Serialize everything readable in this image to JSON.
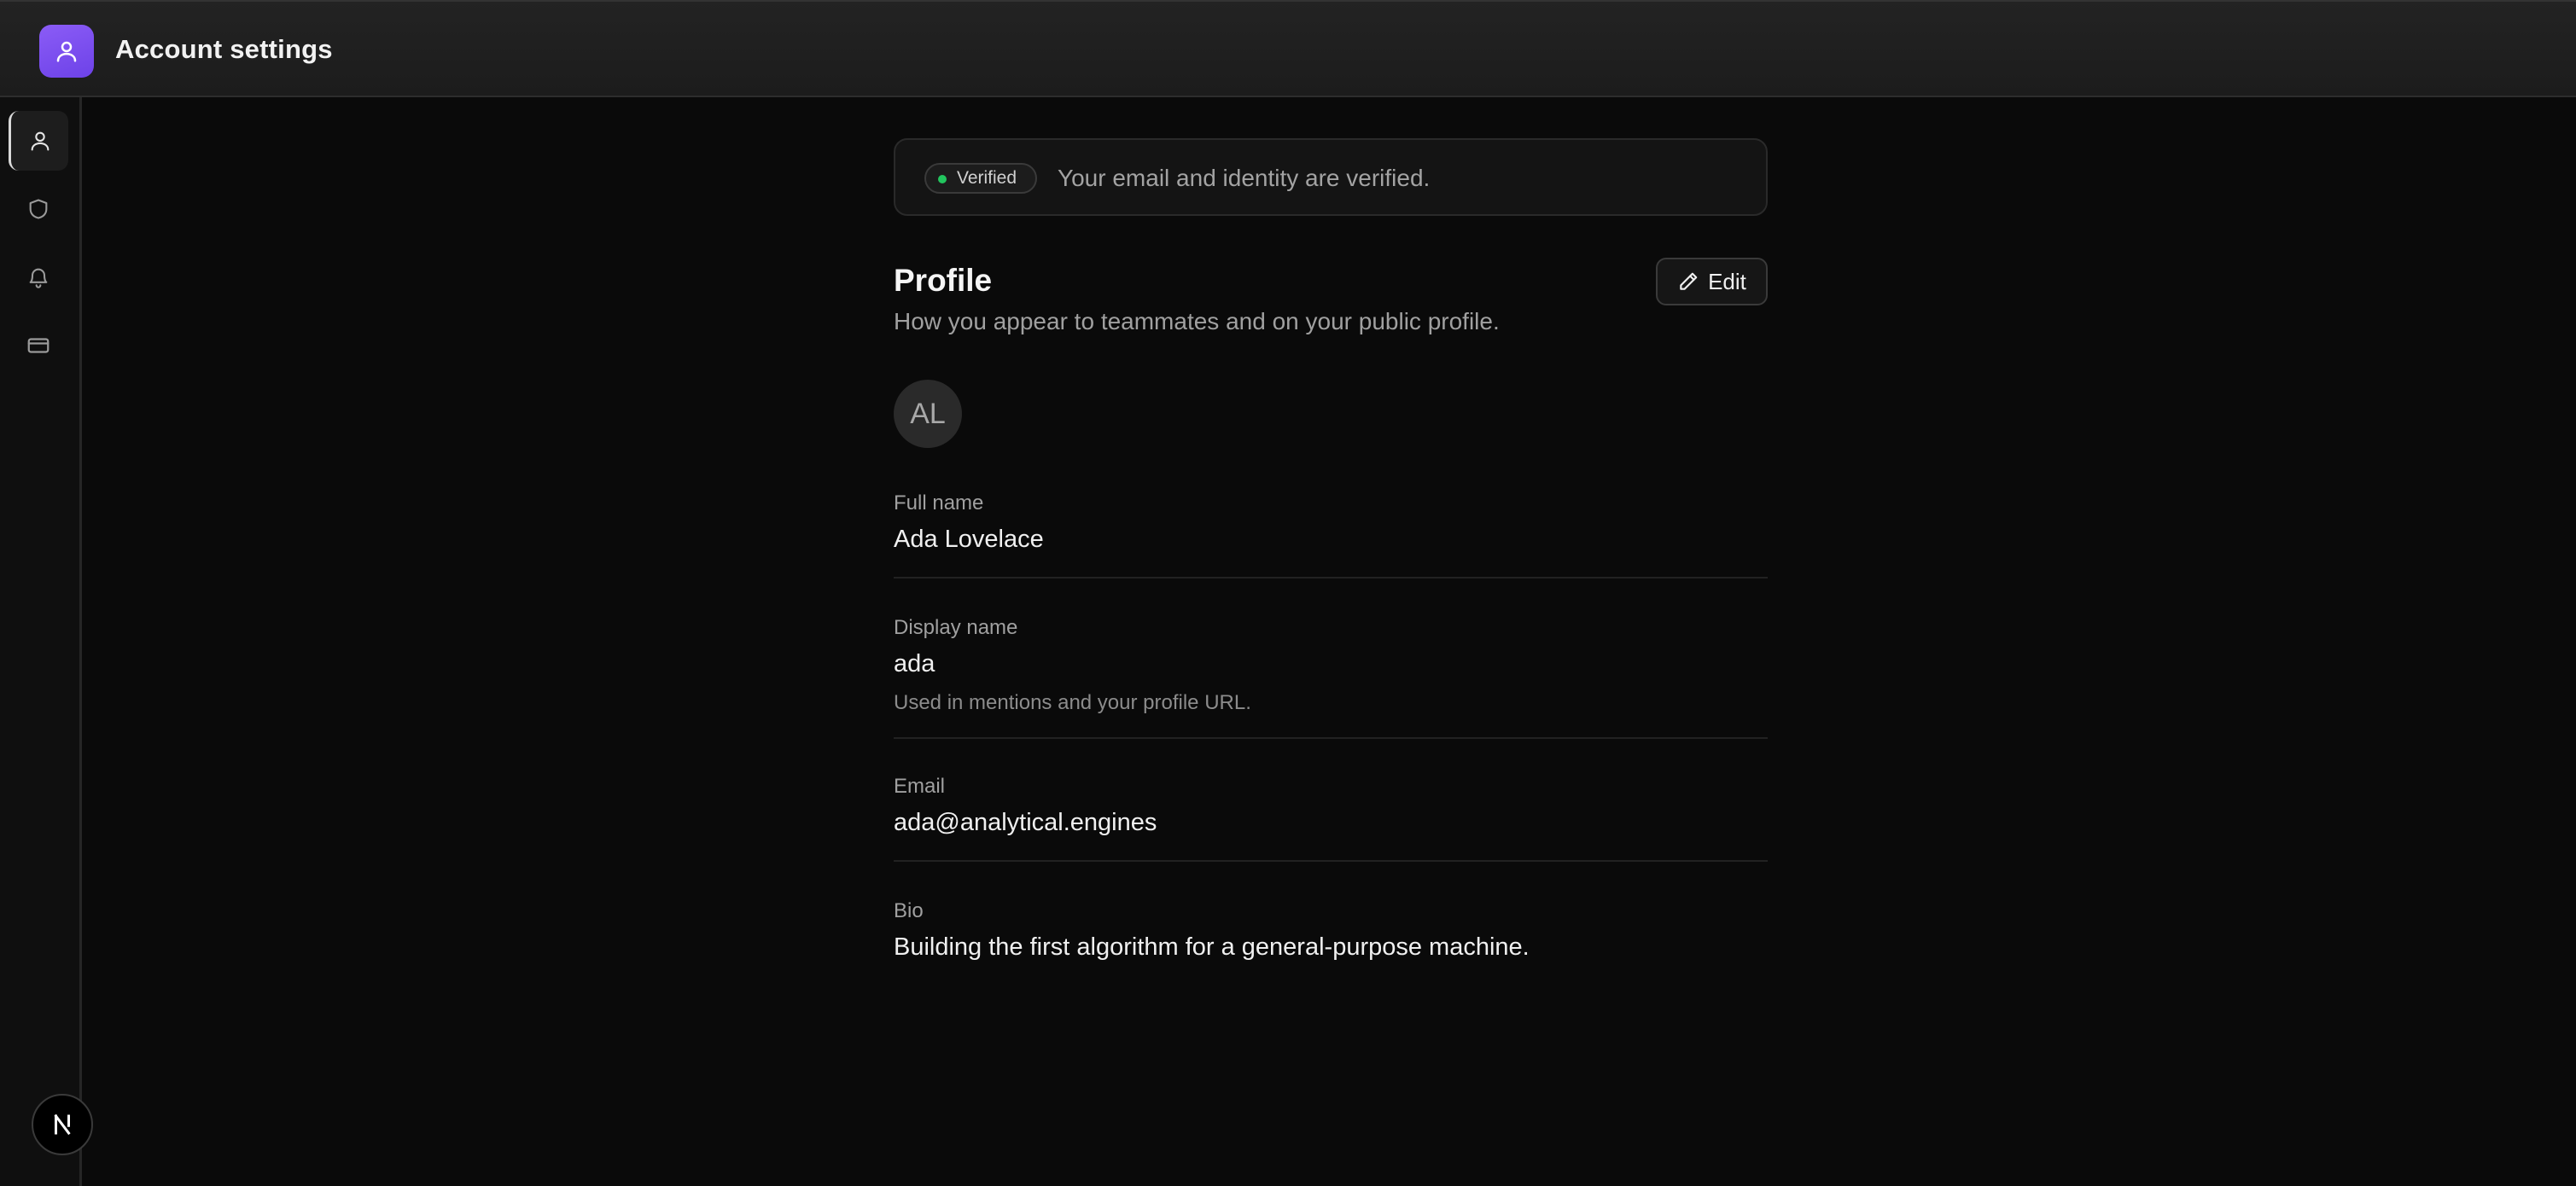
{
  "header": {
    "title": "Account settings",
    "app_icon": "user-icon",
    "accent_color": "#7c4dff"
  },
  "sidebar": {
    "items": [
      {
        "icon": "user-icon",
        "active": true
      },
      {
        "icon": "shield-icon",
        "active": false
      },
      {
        "icon": "bell-icon",
        "active": false
      },
      {
        "icon": "credit-card-icon",
        "active": false
      }
    ],
    "footer_badge": "N"
  },
  "verification": {
    "badge": "Verified",
    "badge_color": "#22c55e",
    "message": "Your email and identity are verified."
  },
  "profile": {
    "title": "Profile",
    "subtitle": "How you appear to teammates and on your public profile.",
    "edit_label": "Edit",
    "avatar_initials": "AL",
    "fields": [
      {
        "label": "Full name",
        "value": "Ada Lovelace"
      },
      {
        "label": "Display name",
        "value": "ada",
        "hint": "Used in mentions and your profile URL."
      },
      {
        "label": "Email",
        "value": "ada@analytical.engines"
      },
      {
        "label": "Bio",
        "value": "Building the first algorithm for a general-purpose machine."
      }
    ]
  }
}
